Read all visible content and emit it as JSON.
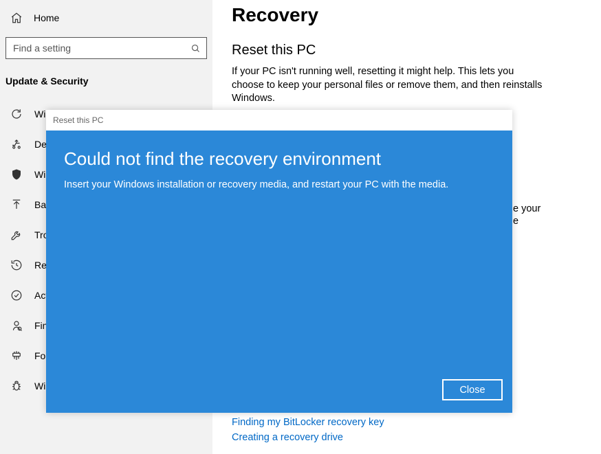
{
  "sidebar": {
    "home_label": "Home",
    "search_placeholder": "Find a setting",
    "group_header": "Update & Security",
    "items": [
      {
        "icon": "refresh",
        "label": "Windows Update"
      },
      {
        "icon": "delivery",
        "label": "Delivery Optimization"
      },
      {
        "icon": "shield",
        "label": "Windows Security"
      },
      {
        "icon": "backup",
        "label": "Backup"
      },
      {
        "icon": "wrench",
        "label": "Troubleshoot"
      },
      {
        "icon": "recovery",
        "label": "Recovery"
      },
      {
        "icon": "check-circle",
        "label": "Activation"
      },
      {
        "icon": "find-device",
        "label": "Find my device"
      },
      {
        "icon": "dev",
        "label": "For developers"
      },
      {
        "icon": "bug",
        "label": "Windows Insider Program"
      }
    ]
  },
  "main": {
    "page_title": "Recovery",
    "section1_title": "Reset this PC",
    "section1_body": "If your PC isn't running well, resetting it might help. This lets you choose to keep your personal files or remove them, and then reinstalls Windows.",
    "peek_right_line1": "e your",
    "peek_right_line2": "e",
    "link1": "Finding my BitLocker recovery key",
    "link2": "Creating a recovery drive"
  },
  "dialog": {
    "titlebar": "Reset this PC",
    "heading": "Could not find the recovery environment",
    "body": "Insert your Windows installation or recovery media, and restart your PC with the media.",
    "close_label": "Close"
  }
}
